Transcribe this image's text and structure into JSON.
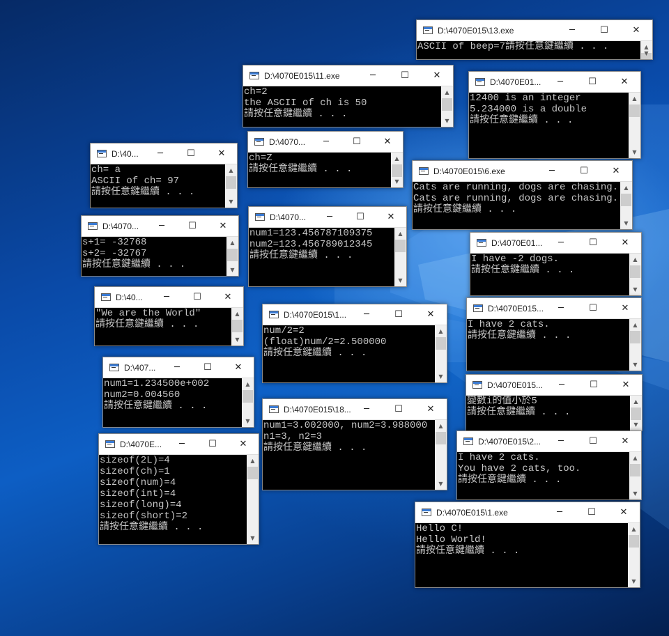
{
  "desktop": {
    "wallpaper": "Windows 10 hero",
    "accent": "#0a4aa8"
  },
  "icons": {
    "app": "console-app-icon",
    "minimize": "─",
    "maximize": "☐",
    "close": "✕",
    "scroll_up": "▲",
    "scroll_down": "▼"
  },
  "windows": [
    {
      "title": "D:\\4070E015\\13.exe",
      "lines": [
        "ASCII of beep=7請按任意鍵繼續 . . ."
      ]
    },
    {
      "title": "D:\\4070E015\\11.exe",
      "lines": [
        "ch=2",
        "the ASCII of ch is 50",
        "請按任意鍵繼續 . . ."
      ]
    },
    {
      "title": "D:\\4070E01...",
      "lines": [
        "12400 is an integer",
        "5.234000 is a double",
        "請按任意鍵繼續 . . ."
      ]
    },
    {
      "title": "D:\\40...",
      "lines": [
        "ch= a",
        "ASCII of ch= 97",
        "請按任意鍵繼續 . . ."
      ]
    },
    {
      "title": "D:\\4070...",
      "lines": [
        "ch=Z",
        "請按任意鍵繼續 . . ."
      ]
    },
    {
      "title": "D:\\4070E015\\6.exe",
      "lines": [
        "Cats are running, dogs are chasing.",
        "Cats are running, dogs are chasing.",
        "請按任意鍵繼續 . . ."
      ]
    },
    {
      "title": "D:\\4070...",
      "lines": [
        "s+1= -32768",
        "s+2= -32767",
        "請按任意鍵繼續 . . ."
      ]
    },
    {
      "title": "D:\\4070...",
      "lines": [
        "num1=123.456787109375",
        "num2=123.456789012345",
        "請按任意鍵繼續 . . ."
      ]
    },
    {
      "title": "D:\\4070E01...",
      "lines": [
        "I have -2 dogs.",
        "請按任意鍵繼續 . . ."
      ]
    },
    {
      "title": "D:\\40...",
      "lines": [
        "\"We are the World\"",
        "請按任意鍵繼續 . . ."
      ]
    },
    {
      "title": "D:\\4070E015\\1...",
      "lines": [
        "num/2=2",
        "(float)num/2=2.500000",
        "請按任意鍵繼續 . . ."
      ]
    },
    {
      "title": "D:\\4070E015...",
      "lines": [
        "I have 2 cats.",
        "請按任意鍵繼續 . . ."
      ]
    },
    {
      "title": "D:\\407...",
      "lines": [
        "num1=1.234500e+002",
        "num2=0.004560",
        "請按任意鍵繼續 . . ."
      ]
    },
    {
      "title": "D:\\4070E015...",
      "lines": [
        "變數i的值小於5",
        "請按任意鍵繼續 . . ."
      ]
    },
    {
      "title": "D:\\4070E015\\18...",
      "lines": [
        "num1=3.002000, num2=3.988000",
        "n1=3, n2=3",
        "請按任意鍵繼續 . . ."
      ]
    },
    {
      "title": "D:\\4070E...",
      "lines": [
        "sizeof(2L)=4",
        "sizeof(ch)=1",
        "sizeof(num)=4",
        "sizeof(int)=4",
        "sizeof(long)=4",
        "sizeof(short)=2",
        "請按任意鍵繼續 . . ."
      ]
    },
    {
      "title": "D:\\4070E015\\2...",
      "lines": [
        "I have 2 cats.",
        "You have 2 cats, too.",
        "請按任意鍵繼續 . . ."
      ]
    },
    {
      "title": "D:\\4070E015\\1.exe",
      "lines": [
        "Hello C!",
        "Hello World!",
        "請按任意鍵繼續 . . ."
      ]
    }
  ]
}
